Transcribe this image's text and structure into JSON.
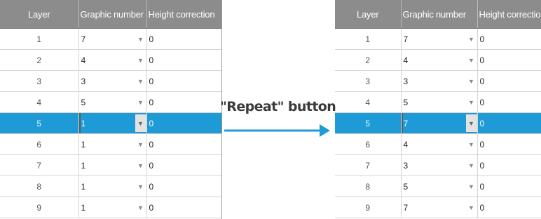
{
  "headers": {
    "layer": "Layer",
    "graphic": "Graphic number",
    "height": "Height correction"
  },
  "annotation": "\"Repeat\" button",
  "colors": {
    "header_bg": "#8c8c8c",
    "selection": "#1e9bd7",
    "arrow": "#1e9bd7"
  },
  "icons": {
    "dropdown": "chevron-down-icon",
    "arrow": "right-arrow-icon"
  },
  "left_table": {
    "selected_row": 5,
    "rows": [
      {
        "layer": "1",
        "graphic": "7",
        "height": "0"
      },
      {
        "layer": "2",
        "graphic": "4",
        "height": "0"
      },
      {
        "layer": "3",
        "graphic": "3",
        "height": "0"
      },
      {
        "layer": "4",
        "graphic": "5",
        "height": "0"
      },
      {
        "layer": "5",
        "graphic": "1",
        "height": "0"
      },
      {
        "layer": "6",
        "graphic": "1",
        "height": "0"
      },
      {
        "layer": "7",
        "graphic": "1",
        "height": "0"
      },
      {
        "layer": "8",
        "graphic": "1",
        "height": "0"
      },
      {
        "layer": "9",
        "graphic": "1",
        "height": "0"
      }
    ]
  },
  "right_table": {
    "selected_row": 5,
    "rows": [
      {
        "layer": "1",
        "graphic": "7",
        "height": "0"
      },
      {
        "layer": "2",
        "graphic": "4",
        "height": "0"
      },
      {
        "layer": "3",
        "graphic": "3",
        "height": "0"
      },
      {
        "layer": "4",
        "graphic": "5",
        "height": "0"
      },
      {
        "layer": "5",
        "graphic": "7",
        "height": "0"
      },
      {
        "layer": "6",
        "graphic": "4",
        "height": "0"
      },
      {
        "layer": "7",
        "graphic": "3",
        "height": "0"
      },
      {
        "layer": "8",
        "graphic": "5",
        "height": "0"
      },
      {
        "layer": "9",
        "graphic": "7",
        "height": "0"
      }
    ]
  }
}
